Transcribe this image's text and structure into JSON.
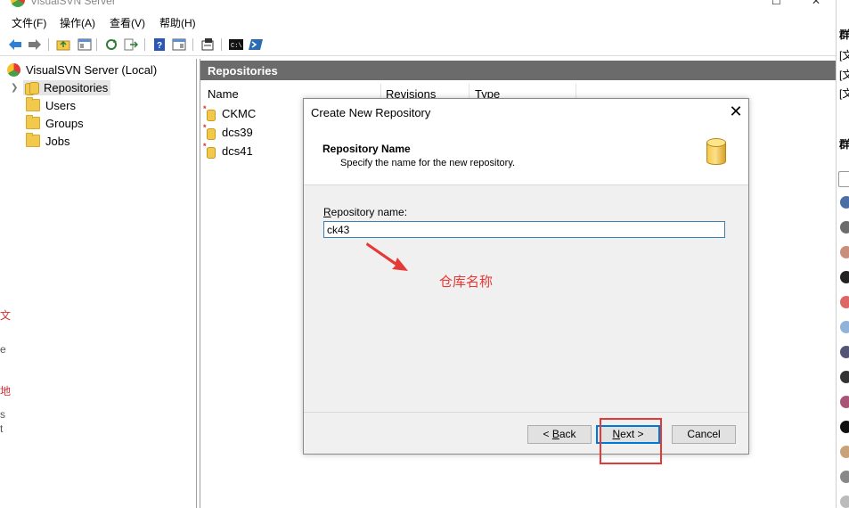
{
  "window": {
    "title": "VisualSVN Server"
  },
  "menu": [
    "文件(F)",
    "操作(A)",
    "查看(V)",
    "帮助(H)"
  ],
  "tree": {
    "root": "VisualSVN Server (Local)",
    "items": [
      "Repositories",
      "Users",
      "Groups",
      "Jobs"
    ]
  },
  "right_pane": {
    "header": "Repositories",
    "columns": [
      "Name",
      "Revisions",
      "Type"
    ],
    "rows": [
      "CKMC",
      "dcs39",
      "dcs41"
    ]
  },
  "dialog": {
    "title": "Create New Repository",
    "close_glyph": "✕",
    "header_title": "Repository Name",
    "header_subtitle": "Specify the name for the new repository.",
    "field_label_accel": "R",
    "field_label_rest": "epository name:",
    "field_value": "ck43",
    "back_prefix": "< ",
    "back_accel": "B",
    "back_rest": "ack",
    "next_accel": "N",
    "next_rest": "ext >",
    "cancel_label": "Cancel"
  },
  "annotation": {
    "text": "仓库名称",
    "color": "#e53935"
  },
  "chat_strip": {
    "texts": [
      "群",
      "[文",
      "[文",
      "[文",
      "群"
    ]
  },
  "colors": {
    "header_bg": "#6b6b6b",
    "accent": "#0078d7",
    "folder": "#f2c94c",
    "annotation": "#e53935"
  }
}
